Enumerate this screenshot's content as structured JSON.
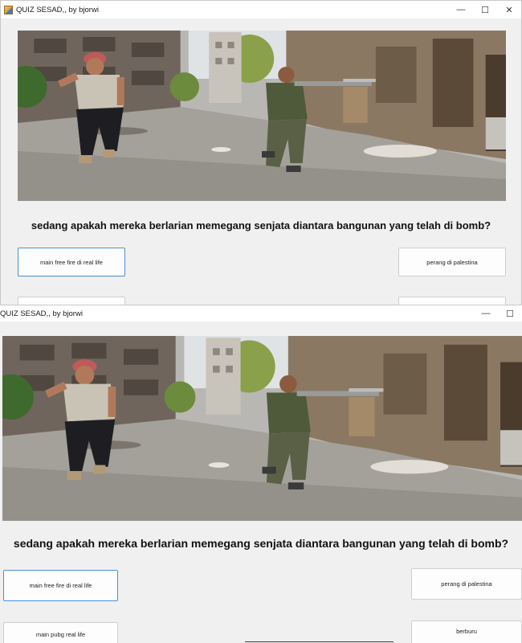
{
  "top_window": {
    "title": "QUIZ SESAD,, by bjorwi",
    "controls": {
      "minimize": "—",
      "maximize": "☐",
      "close": "✕"
    },
    "question": "sedang apakah mereka berlarian memegang senjata diantara bangunan yang telah di bomb?",
    "answers": [
      "main free fire di real life",
      "perang di palestina"
    ]
  },
  "bottom_window": {
    "title": "QUIZ SESAD,, by bjorwi",
    "controls": {
      "minimize": "—",
      "maximize": "☐"
    },
    "question": "sedang apakah mereka berlarian memegang senjata diantara bangunan yang telah di bomb?",
    "answers": [
      "main free fire di real life",
      "perang di palestina",
      "main pubg real life",
      "berburu"
    ]
  }
}
